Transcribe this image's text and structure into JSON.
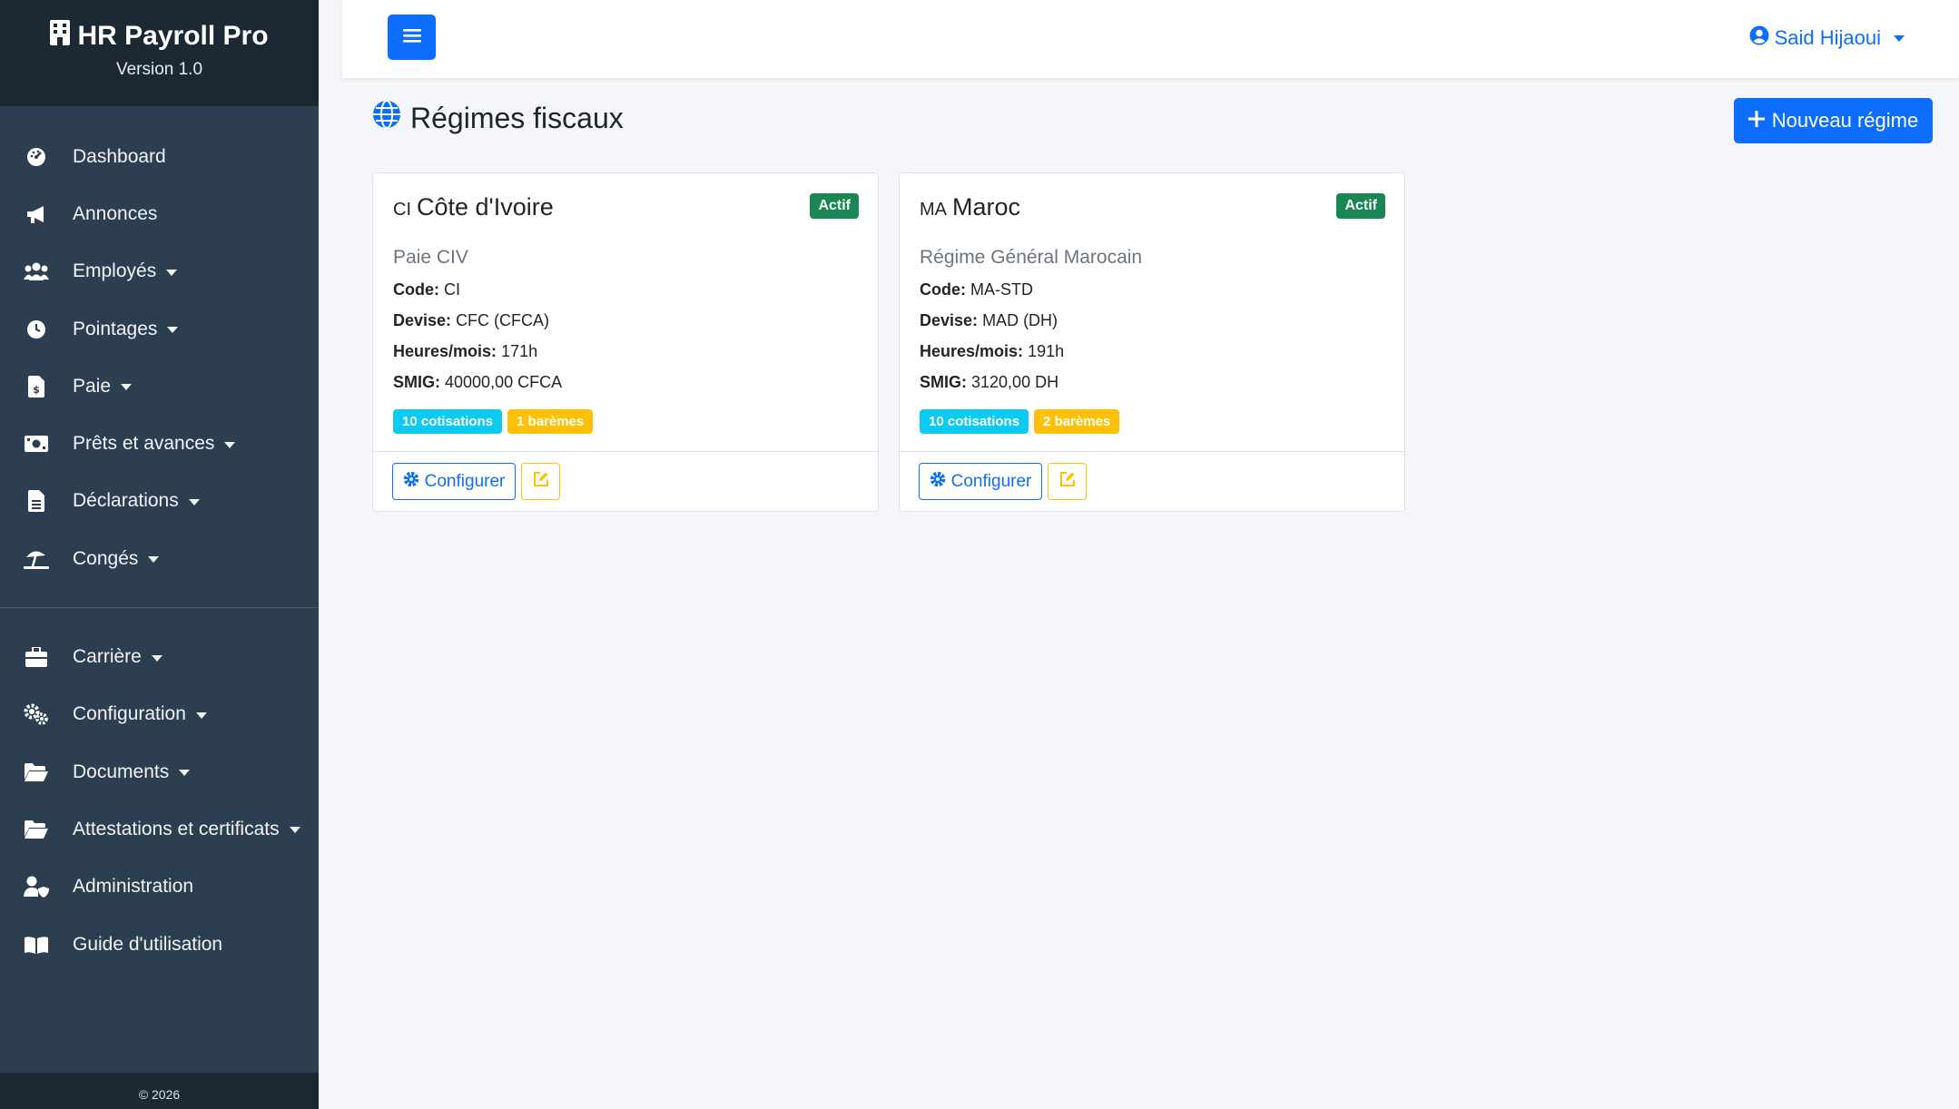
{
  "app": {
    "title": "HR Payroll Pro",
    "version": "Version 1.0",
    "footer": "© 2026"
  },
  "sidebar": {
    "items": [
      {
        "label": "Dashboard",
        "icon": "dashboard-icon"
      },
      {
        "label": "Annonces",
        "icon": "megaphone-icon"
      },
      {
        "label": "Employés",
        "icon": "users-icon"
      },
      {
        "label": "Pointages",
        "icon": "clock-icon"
      },
      {
        "label": "Paie",
        "icon": "invoice-dollar-icon"
      },
      {
        "label": "Prêts et avances",
        "icon": "money-bill-icon"
      },
      {
        "label": "Déclarations",
        "icon": "file-text-icon"
      },
      {
        "label": "Congés",
        "icon": "umbrella-beach-icon"
      },
      {
        "label": "Carrière",
        "icon": "briefcase-icon"
      },
      {
        "label": "Configuration",
        "icon": "cogs-icon"
      },
      {
        "label": "Documents",
        "icon": "folder-open-icon"
      },
      {
        "label": "Attestations et certificats",
        "icon": "folder-open-icon"
      },
      {
        "label": "Administration",
        "icon": "user-shield-icon"
      },
      {
        "label": "Guide d'utilisation",
        "icon": "book-icon"
      }
    ]
  },
  "topbar": {
    "user_name": "Said Hijaoui"
  },
  "page": {
    "title": "Régimes fiscaux",
    "new_button": "Nouveau régime"
  },
  "regimes": [
    {
      "code_prefix": "CI",
      "country": "Côte d'Ivoire",
      "status": "Actif",
      "name": "Paie CIV",
      "code_label": "Code:",
      "code": "CI",
      "devise_label": "Devise:",
      "devise": "CFC (CFCA)",
      "heures_label": "Heures/mois:",
      "heures": "171h",
      "smig_label": "SMIG:",
      "smig": "40000,00 CFCA",
      "cotisations": "10 cotisations",
      "baremes": "1 barèmes",
      "configure_label": "Configurer"
    },
    {
      "code_prefix": "MA",
      "country": "Maroc",
      "status": "Actif",
      "name": "Régime Général Marocain",
      "code_label": "Code:",
      "code": "MA-STD",
      "devise_label": "Devise:",
      "devise": "MAD (DH)",
      "heures_label": "Heures/mois:",
      "heures": "191h",
      "smig_label": "SMIG:",
      "smig": "3120,00 DH",
      "cotisations": "10 cotisations",
      "baremes": "2 barèmes",
      "configure_label": "Configurer"
    }
  ],
  "colors": {
    "sidebar_bg": "#2c3e50",
    "sidebar_brand_bg": "#1c2833",
    "primary": "#0d6efd",
    "success": "#198754",
    "info": "#0dcaf0",
    "warning": "#ffc107"
  }
}
